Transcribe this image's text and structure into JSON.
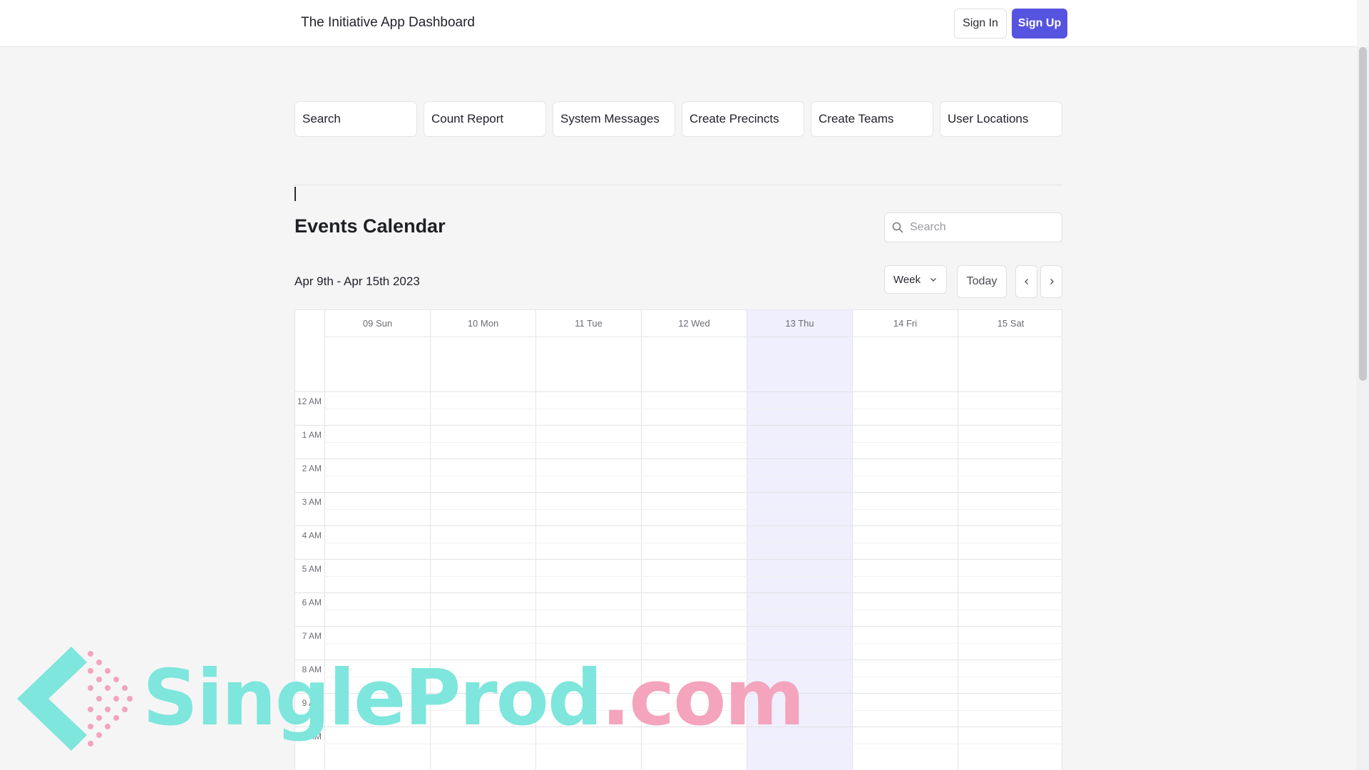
{
  "header": {
    "app_title": "The Initiative App Dashboard",
    "sign_in_label": "Sign In",
    "sign_up_label": "Sign Up",
    "accent_color": "#5653e0"
  },
  "nav_cards": [
    {
      "label": "Search"
    },
    {
      "label": "Count Report"
    },
    {
      "label": "System Messages"
    },
    {
      "label": "Create Precincts"
    },
    {
      "label": "Create Teams"
    },
    {
      "label": "User Locations"
    }
  ],
  "calendar": {
    "title": "Events Calendar",
    "search_placeholder": "Search",
    "date_range": "Apr 9th - Apr 15th 2023",
    "view": "Week",
    "today_label": "Today",
    "prev_icon": "chevron-left-icon",
    "next_icon": "chevron-right-icon",
    "days": [
      {
        "label": "09 Sun",
        "today": false
      },
      {
        "label": "10 Mon",
        "today": false
      },
      {
        "label": "11 Tue",
        "today": false
      },
      {
        "label": "12 Wed",
        "today": false
      },
      {
        "label": "13 Thu",
        "today": true
      },
      {
        "label": "14 Fri",
        "today": false
      },
      {
        "label": "15 Sat",
        "today": false
      }
    ],
    "hours": [
      "12 AM",
      "1 AM",
      "2 AM",
      "3 AM",
      "4 AM",
      "5 AM",
      "6 AM",
      "7 AM",
      "8 AM",
      "9 AM",
      "10 AM"
    ],
    "today_color": "#efeffd"
  },
  "watermark": {
    "text_part1": "SingleProd",
    "text_part2": ".com"
  }
}
